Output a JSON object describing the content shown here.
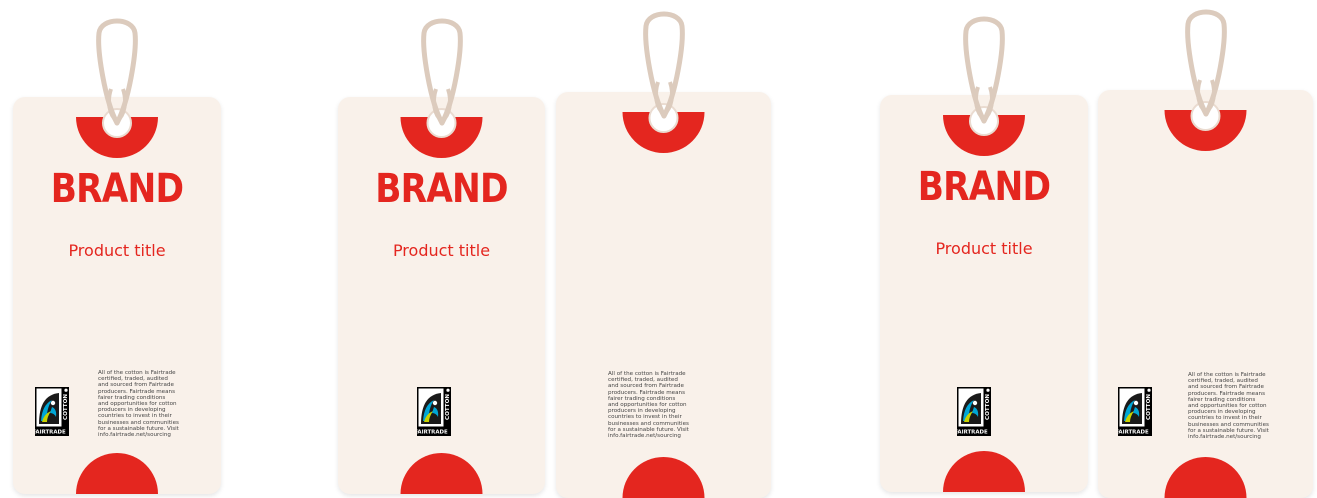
{
  "brand": {
    "name": "BRAND",
    "product_title": "Product title"
  },
  "fairtrade": {
    "text": "All of the cotton is Fairtrade\ncertified, traded, audited\nand sourced from Fairtrade\nproducers. Fairtrade means\nfairer trading conditions\nand opportunities for cotton\nproducers in developing\ncountries to invest in their\nbusinesses and communities\nfor a sustainable future. Visit\ninfo.fairtrade.net/sourcing",
    "logo_word": "FAIRTRADE",
    "logo_side": "COTTON"
  },
  "colors": {
    "accent": "#e4261f",
    "card": "#f9f1ea",
    "string": "#dccbbd",
    "logo_bg": "#000000"
  },
  "tags": [
    {
      "name": "tag-1",
      "brand": true,
      "title": true,
      "logo": true,
      "text": true
    },
    {
      "name": "tag-2",
      "brand": true,
      "title": true,
      "logo": true,
      "text": false
    },
    {
      "name": "tag-3",
      "brand": false,
      "title": false,
      "logo": false,
      "text": true
    },
    {
      "name": "tag-4",
      "brand": true,
      "title": true,
      "logo": true,
      "text": false
    },
    {
      "name": "tag-5",
      "brand": false,
      "title": false,
      "logo": true,
      "text": true
    }
  ]
}
